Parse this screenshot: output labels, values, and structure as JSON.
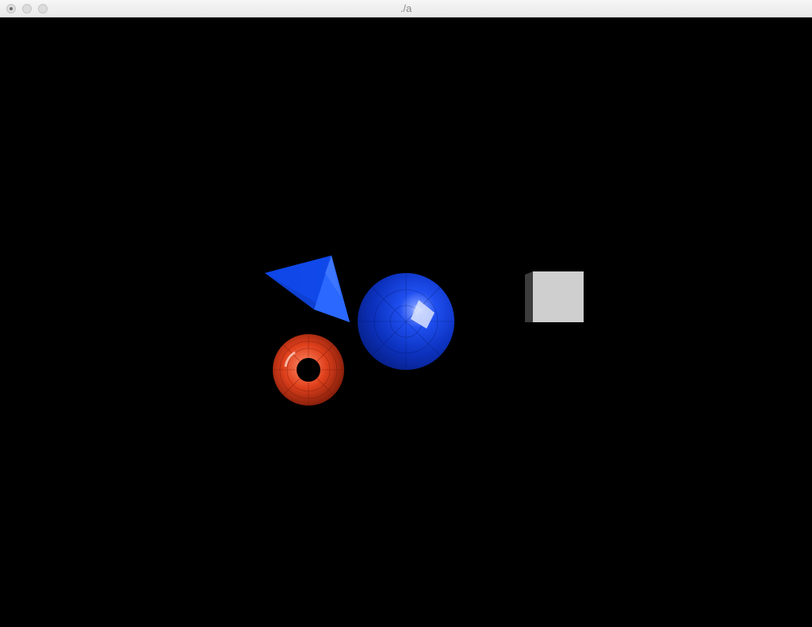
{
  "window": {
    "title": "./a"
  },
  "scene": {
    "background_color": "#000000",
    "objects": [
      {
        "shape": "cone",
        "color": "#1a5cff"
      },
      {
        "shape": "sphere",
        "color": "#0a3fd6"
      },
      {
        "shape": "torus",
        "color": "#e0401c"
      },
      {
        "shape": "cube",
        "color": "#cfcfcf"
      }
    ]
  }
}
